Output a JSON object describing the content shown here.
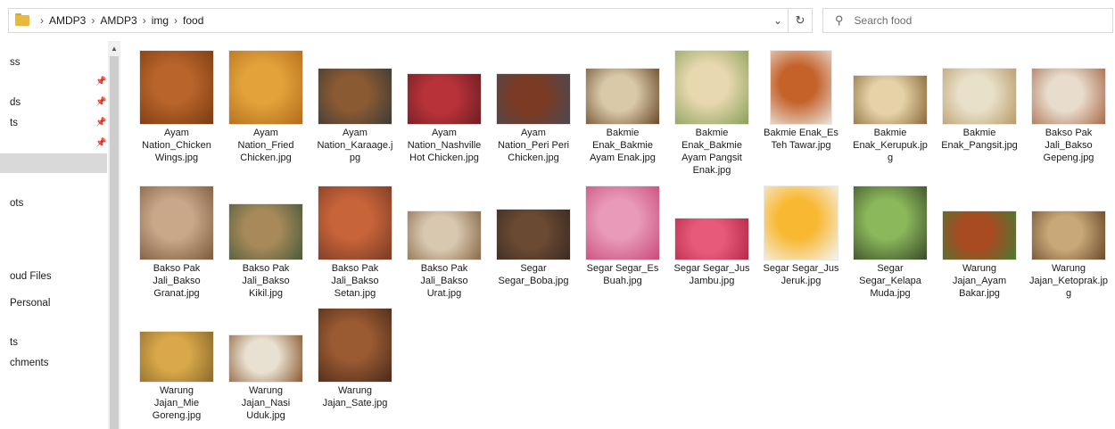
{
  "address": {
    "crumbs": [
      "AMDP3",
      "AMDP3",
      "img",
      "food"
    ],
    "separator": "›",
    "dropdown_glyph": "⌄",
    "refresh_glyph": "↻"
  },
  "search": {
    "placeholder": "Search food",
    "value": "",
    "icon": "search-icon"
  },
  "sidebar": {
    "items": [
      {
        "label": "ss",
        "pinned": false
      },
      {
        "label": "",
        "pinned": true
      },
      {
        "label": "ds",
        "pinned": true
      },
      {
        "label": "ts",
        "pinned": true
      },
      {
        "label": "",
        "pinned": true
      },
      {
        "label": "",
        "selected": true
      },
      {
        "label": "ots"
      },
      {
        "label": "oud Files"
      },
      {
        "label": "Personal"
      },
      {
        "label": "ts"
      },
      {
        "label": "chments"
      }
    ]
  },
  "files": [
    {
      "name": "Ayam Nation_Chicken Wings.jpg",
      "lines": [
        "Ayam",
        "Nation_Chicken",
        "Wings.jpg"
      ],
      "colors": [
        "#b8642a",
        "#7a3b12"
      ]
    },
    {
      "name": "Ayam Nation_Fried Chicken.jpg",
      "lines": [
        "Ayam",
        "Nation_Fried",
        "Chicken.jpg"
      ],
      "colors": [
        "#e2a33a",
        "#b36b1c"
      ]
    },
    {
      "name": "Ayam Nation_Karaage.jpg",
      "lines": [
        "Ayam",
        "Nation_Karaage.j",
        "pg"
      ],
      "colors": [
        "#8a5a32",
        "#3d3a38"
      ]
    },
    {
      "name": "Ayam Nation_Nashville Hot Chicken.jpg",
      "lines": [
        "Ayam",
        "Nation_Nashville",
        "Hot Chicken.jpg"
      ],
      "colors": [
        "#b8323a",
        "#6e1e24"
      ]
    },
    {
      "name": "Ayam Nation_Peri Peri Chicken.jpg",
      "lines": [
        "Ayam",
        "Nation_Peri Peri",
        "Chicken.jpg"
      ],
      "colors": [
        "#7a3a24",
        "#4a4a52"
      ]
    },
    {
      "name": "Bakmie Enak_Bakmie Ayam Enak.jpg",
      "lines": [
        "Bakmie",
        "Enak_Bakmie",
        "Ayam Enak.jpg"
      ],
      "colors": [
        "#d9c9a8",
        "#6b4a2a"
      ]
    },
    {
      "name": "Bakmie Enak_Bakmie Ayam Pangsit Enak.jpg",
      "lines": [
        "Bakmie",
        "Enak_Bakmie",
        "Ayam Pangsit",
        "Enak.jpg"
      ],
      "colors": [
        "#e8d8b0",
        "#8aa05a"
      ]
    },
    {
      "name": "Bakmie Enak_Es Teh Tawar.jpg",
      "lines": [
        "Bakmie Enak_Es",
        "Teh Tawar.jpg"
      ],
      "colors": [
        "#c4622a",
        "#e9e4dc"
      ]
    },
    {
      "name": "Bakmie Enak_Kerupuk.jpg",
      "lines": [
        "Bakmie",
        "Enak_Kerupuk.jp",
        "g"
      ],
      "colors": [
        "#e6d2a8",
        "#8a6a3a"
      ]
    },
    {
      "name": "Bakmie Enak_Pangsit.jpg",
      "lines": [
        "Bakmie",
        "Enak_Pangsit.jpg"
      ],
      "colors": [
        "#e8e0c8",
        "#b89a6a"
      ]
    },
    {
      "name": "Bakso Pak Jali_Bakso Gepeng.jpg",
      "lines": [
        "Bakso Pak",
        "Jali_Bakso",
        "Gepeng.jpg"
      ],
      "colors": [
        "#e8dccc",
        "#a86a4a"
      ]
    },
    {
      "name": "Bakso Pak Jali_Bakso Granat.jpg",
      "lines": [
        "Bakso Pak",
        "Jali_Bakso",
        "Granat.jpg"
      ],
      "colors": [
        "#c8a888",
        "#7a5a3a"
      ]
    },
    {
      "name": "Bakso Pak Jali_Bakso Kikil.jpg",
      "lines": [
        "Bakso Pak",
        "Jali_Bakso",
        "Kikil.jpg"
      ],
      "colors": [
        "#a88a5a",
        "#4a5a3a"
      ]
    },
    {
      "name": "Bakso Pak Jali_Bakso Setan.jpg",
      "lines": [
        "Bakso Pak",
        "Jali_Bakso",
        "Setan.jpg"
      ],
      "colors": [
        "#c8643a",
        "#7a3a24"
      ]
    },
    {
      "name": "Bakso Pak Jali_Bakso Urat.jpg",
      "lines": [
        "Bakso Pak",
        "Jali_Bakso",
        "Urat.jpg"
      ],
      "colors": [
        "#d8c8b0",
        "#8a6a4a"
      ]
    },
    {
      "name": "Segar Segar_Boba.jpg",
      "lines": [
        "Segar",
        "Segar_Boba.jpg"
      ],
      "colors": [
        "#6a4a32",
        "#3a2a22"
      ]
    },
    {
      "name": "Segar Segar_Es Buah.jpg",
      "lines": [
        "Segar Segar_Es",
        "Buah.jpg"
      ],
      "colors": [
        "#e89ab8",
        "#c84a7a"
      ]
    },
    {
      "name": "Segar Segar_Jus Jambu.jpg",
      "lines": [
        "Segar Segar_Jus",
        "Jambu.jpg"
      ],
      "colors": [
        "#e85a7a",
        "#b82a4a"
      ]
    },
    {
      "name": "Segar Segar_Jus Jeruk.jpg",
      "lines": [
        "Segar Segar_Jus",
        "Jeruk.jpg"
      ],
      "colors": [
        "#f8b832",
        "#f4f4f4"
      ]
    },
    {
      "name": "Segar Segar_Kelapa Muda.jpg",
      "lines": [
        "Segar",
        "Segar_Kelapa",
        "Muda.jpg"
      ],
      "colors": [
        "#8ab85a",
        "#3a4a2a"
      ]
    },
    {
      "name": "Warung Jajan_Ayam Bakar.jpg",
      "lines": [
        "Warung",
        "Jajan_Ayam",
        "Bakar.jpg"
      ],
      "colors": [
        "#a84a22",
        "#4a7a32"
      ]
    },
    {
      "name": "Warung Jajan_Ketoprak.jpg",
      "lines": [
        "Warung",
        "Jajan_Ketoprak.jp",
        "g"
      ],
      "colors": [
        "#c8a878",
        "#6a4a2a"
      ]
    },
    {
      "name": "Warung Jajan_Mie Goreng.jpg",
      "lines": [
        "Warung",
        "Jajan_Mie",
        "Goreng.jpg"
      ],
      "colors": [
        "#d8a84a",
        "#8a6a2a"
      ]
    },
    {
      "name": "Warung Jajan_Nasi Uduk.jpg",
      "lines": [
        "Warung",
        "Jajan_Nasi",
        "Uduk.jpg"
      ],
      "colors": [
        "#e8e0d0",
        "#8a5a32"
      ]
    },
    {
      "name": "Warung Jajan_Sate.jpg",
      "lines": [
        "Warung",
        "Jajan_Sate.jpg"
      ],
      "colors": [
        "#9a5a32",
        "#4a2a1a"
      ]
    }
  ]
}
